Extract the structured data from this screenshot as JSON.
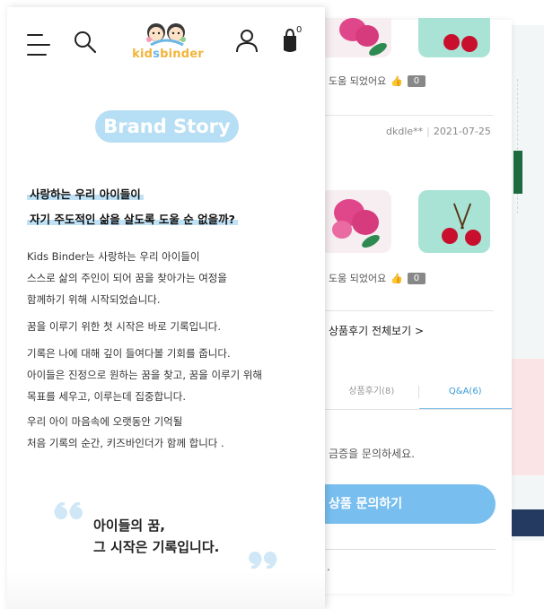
{
  "header": {
    "logo_text_a": "kid",
    "logo_text_s": "s",
    "logo_text_b": "binder",
    "cart_count": "0",
    "icons": [
      "menu-icon",
      "search-icon",
      "user-icon",
      "cart-icon"
    ]
  },
  "brand_story": {
    "title": "Brand Story",
    "headline_1": "사랑하는 우리 아이들이",
    "headline_2": "자기 주도적인 삶을 살도록 도울 순 없을까?",
    "para_1_line_1": "Kids Binder는 사랑하는 우리 아이들이",
    "para_1_line_2": "스스로 삶의 주인이 되어 꿈을 찾아가는 여정을",
    "para_1_line_3": "함께하기 위해 시작되었습니다.",
    "para_2": "꿈을 이루기 위한 첫 시작은 바로 기록입니다.",
    "para_3_line_1": "기록은 나에 대해 깊이 들여다볼 기회를 줍니다.",
    "para_3_line_2": "아이들은 진정으로 원하는 꿈을 찾고, 꿈을 이루기 위해",
    "para_3_line_3": "목표를 세우고, 이루는데 집중합니다.",
    "para_4_line_1": "우리 아이 마음속에 오랫동안 기억될",
    "para_4_line_2": "처음 기록의 순간, 키즈바인더가 함께 합니다 .",
    "quote_line_1": "아이들의 꿈,",
    "quote_line_2": "그 시작은 기록입니다."
  },
  "reviews": {
    "helpful_label": "도움 되었어요",
    "helpful_count_1": "0",
    "helpful_count_2": "0",
    "reviewer": "dkdle**",
    "date": "2021-07-25",
    "see_all": "상품후기 전체보기 >",
    "tab_reviews": "상품후기(8)",
    "tab_qa": "Q&A(6)",
    "inquiry_prompt": "금증을 문의하세요.",
    "inquiry_button": "상품 문의하기",
    "tail": "."
  },
  "colors": {
    "accent_blue": "#78bff0",
    "pill_blue": "#b6def4",
    "logo_yellow": "#f2b43a",
    "thumb_mint": "#a9e3d6",
    "cherry_red": "#c8102e"
  }
}
